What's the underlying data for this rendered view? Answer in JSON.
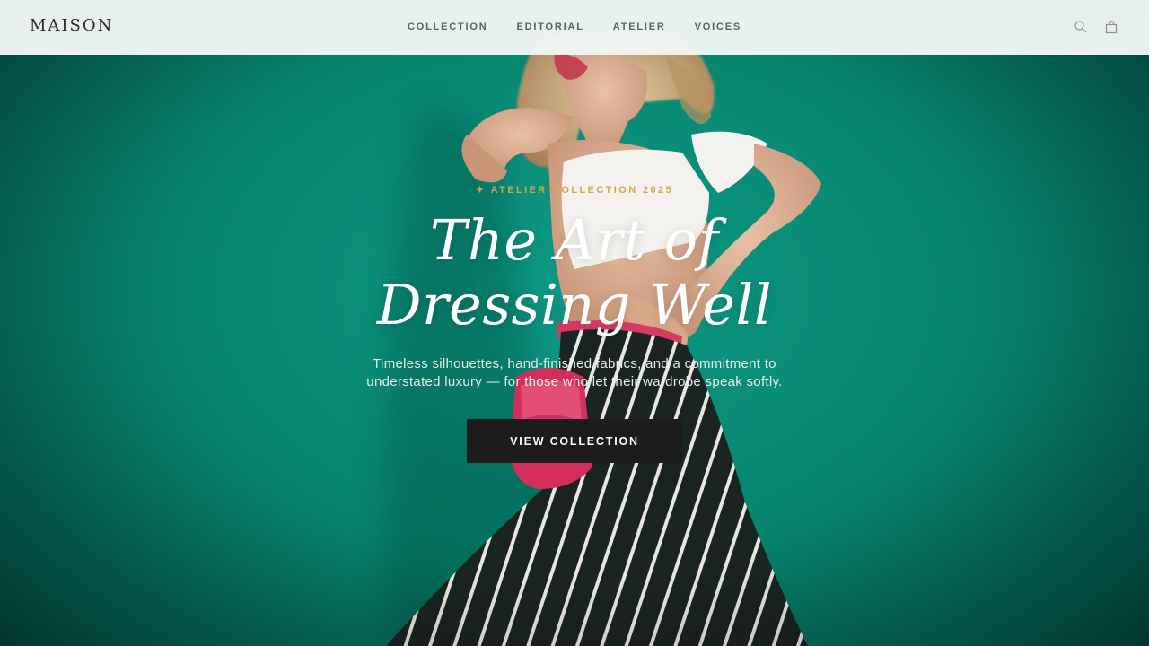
{
  "header": {
    "logo": "MAISON",
    "nav": [
      {
        "label": "COLLECTION"
      },
      {
        "label": "EDITORIAL"
      },
      {
        "label": "ATELIER"
      },
      {
        "label": "VOICES"
      }
    ],
    "actions": {
      "search_icon": "search-icon",
      "bag_icon": "shopping-bag-icon"
    }
  },
  "hero": {
    "eyebrow": "✦ ATELIER COLLECTION 2025",
    "title_line1": "The Art of",
    "title_line2": "Dressing Well",
    "subtitle_line1": "Timeless silhouettes, hand-finished fabrics, and a commitment to",
    "subtitle_line2": "understated luxury — for those who let their wardrobe speak softly.",
    "cta_label": "VIEW COLLECTION"
  },
  "colors": {
    "background_teal": "#0a8a78",
    "accent_gold": "#d3a54a",
    "cta_dark": "#1c1c1c",
    "header_bg": "#f0f7f6"
  }
}
